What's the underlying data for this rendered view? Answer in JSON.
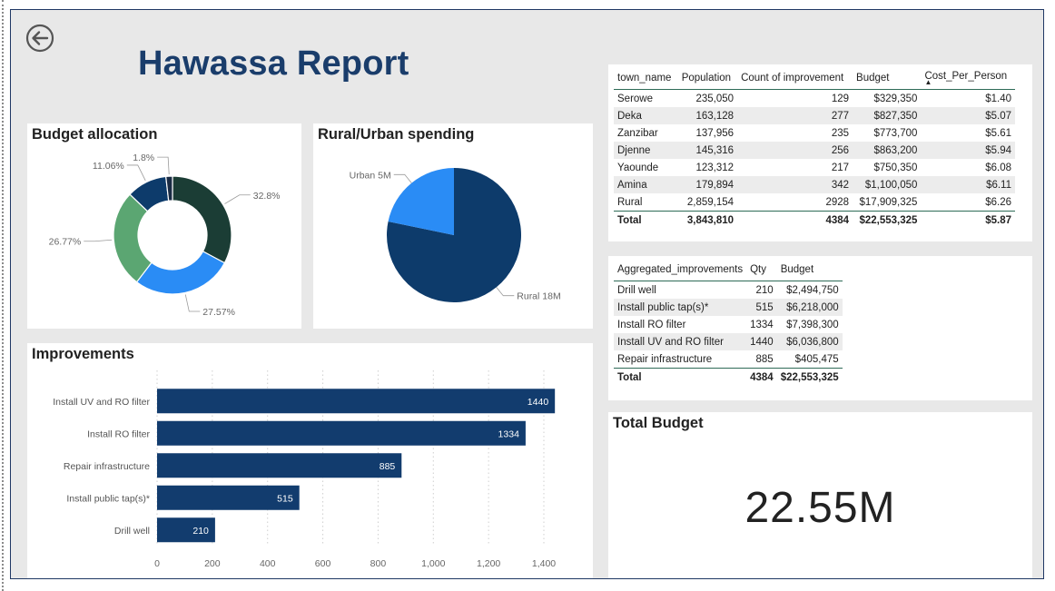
{
  "header": {
    "title": "Hawassa Report"
  },
  "budget_allocation": {
    "title": "Budget allocation",
    "chart_data": {
      "type": "pie",
      "style": "donut",
      "slices": [
        {
          "label": "32.8%",
          "value": 32.8,
          "color": "#1b3d35"
        },
        {
          "label": "27.57%",
          "value": 27.57,
          "color": "#2a8cf5"
        },
        {
          "label": "26.77%",
          "value": 26.77,
          "color": "#5ba672"
        },
        {
          "label": "11.06%",
          "value": 11.06,
          "color": "#0d3b6b"
        },
        {
          "label": "1.8%",
          "value": 1.8,
          "color": "#1a2b44"
        }
      ]
    }
  },
  "rural_urban": {
    "title": "Rural/Urban spending",
    "chart_data": {
      "type": "pie",
      "slices": [
        {
          "label": "Rural 18M",
          "value": 18,
          "color": "#0d3b6b"
        },
        {
          "label": "Urban 5M",
          "value": 5,
          "color": "#2a8cf5"
        }
      ]
    }
  },
  "improvements": {
    "title": "Improvements",
    "chart_data": {
      "type": "bar",
      "orientation": "horizontal",
      "categories": [
        "Install UV and RO filter",
        "Install RO filter",
        "Repair infrastructure",
        "Install public tap(s)*",
        "Drill well"
      ],
      "values": [
        1440,
        1334,
        885,
        515,
        210
      ],
      "xlim": [
        0,
        1450
      ],
      "xticks": [
        0,
        200,
        400,
        600,
        800,
        1000,
        1200,
        1400
      ],
      "xtick_labels": [
        "0",
        "200",
        "400",
        "600",
        "800",
        "1,000",
        "1,200",
        "1,400"
      ],
      "bar_color": "#123c6e",
      "grid": "vertical-dotted"
    }
  },
  "town_table": {
    "headers": [
      "town_name",
      "Population",
      "Count of improvement",
      "Budget",
      "Cost_Per_Person"
    ],
    "sort_indicator": "▲",
    "rows": [
      [
        "Serowe",
        "235,050",
        "129",
        "$329,350",
        "$1.40"
      ],
      [
        "Deka",
        "163,128",
        "277",
        "$827,350",
        "$5.07"
      ],
      [
        "Zanzibar",
        "137,956",
        "235",
        "$773,700",
        "$5.61"
      ],
      [
        "Djenne",
        "145,316",
        "256",
        "$863,200",
        "$5.94"
      ],
      [
        "Yaounde",
        "123,312",
        "217",
        "$750,350",
        "$6.08"
      ],
      [
        "Amina",
        "179,894",
        "342",
        "$1,100,050",
        "$6.11"
      ],
      [
        "Rural",
        "2,859,154",
        "2928",
        "$17,909,325",
        "$6.26"
      ]
    ],
    "total": [
      "Total",
      "3,843,810",
      "4384",
      "$22,553,325",
      "$5.87"
    ]
  },
  "agg_table": {
    "headers": [
      "Aggregated_improvements",
      "Qty",
      "Budget"
    ],
    "rows": [
      [
        "Drill well",
        "210",
        "$2,494,750"
      ],
      [
        "Install public tap(s)*",
        "515",
        "$6,218,000"
      ],
      [
        "Install RO filter",
        "1334",
        "$7,398,300"
      ],
      [
        "Install UV and RO filter",
        "1440",
        "$6,036,800"
      ],
      [
        "Repair infrastructure",
        "885",
        "$405,475"
      ]
    ],
    "total": [
      "Total",
      "4384",
      "$22,553,325"
    ]
  },
  "total_budget": {
    "title": "Total Budget",
    "value": "22.55M"
  }
}
